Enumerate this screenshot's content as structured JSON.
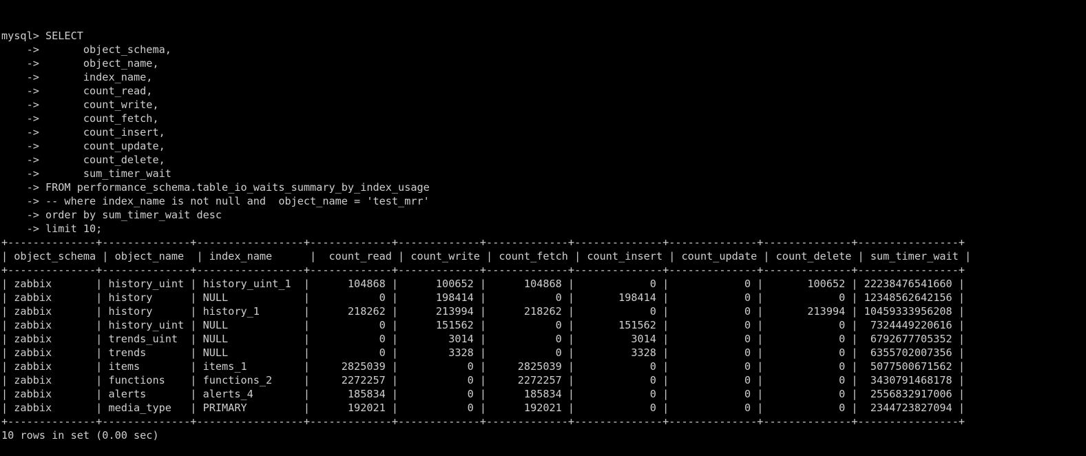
{
  "terminal": {
    "colors": {
      "background": "#000000",
      "foreground": "#cfcfcf"
    },
    "prompt": "mysql> ",
    "continuation": "    -> ",
    "command_first_line": "SELECT",
    "query_lines": [
      "      object_schema,",
      "      object_name,",
      "      index_name,",
      "      count_read,",
      "      count_write,",
      "      count_fetch,",
      "      count_insert,",
      "      count_update,",
      "      count_delete,",
      "      sum_timer_wait",
      "FROM performance_schema.table_io_waits_summary_by_index_usage",
      "-- where index_name is not null and  object_name = 'test_mrr'",
      "order by sum_timer_wait desc",
      "limit 10;"
    ],
    "status_line": "10 rows in set (0.00 sec)"
  },
  "result_table": {
    "columns": [
      {
        "name": "object_schema",
        "width": 13,
        "align": "left"
      },
      {
        "name": "object_name",
        "width": 13,
        "align": "left"
      },
      {
        "name": "index_name",
        "width": 16,
        "align": "left"
      },
      {
        "name": "count_read",
        "width": 12,
        "align": "right"
      },
      {
        "name": "count_write",
        "width": 12,
        "align": "right"
      },
      {
        "name": "count_fetch",
        "width": 12,
        "align": "right"
      },
      {
        "name": "count_insert",
        "width": 13,
        "align": "right"
      },
      {
        "name": "count_update",
        "width": 13,
        "align": "right"
      },
      {
        "name": "count_delete",
        "width": 13,
        "align": "right"
      },
      {
        "name": "sum_timer_wait",
        "width": 15,
        "align": "right"
      }
    ],
    "rows": [
      [
        "zabbix",
        "history_uint",
        "history_uint_1",
        "104868",
        "100652",
        "104868",
        "0",
        "0",
        "100652",
        "22238476541660"
      ],
      [
        "zabbix",
        "history",
        "NULL",
        "0",
        "198414",
        "0",
        "198414",
        "0",
        "0",
        "12348562642156"
      ],
      [
        "zabbix",
        "history",
        "history_1",
        "218262",
        "213994",
        "218262",
        "0",
        "0",
        "213994",
        "10459333956208"
      ],
      [
        "zabbix",
        "history_uint",
        "NULL",
        "0",
        "151562",
        "0",
        "151562",
        "0",
        "0",
        "7324449220616"
      ],
      [
        "zabbix",
        "trends_uint",
        "NULL",
        "0",
        "3014",
        "0",
        "3014",
        "0",
        "0",
        "6792677705352"
      ],
      [
        "zabbix",
        "trends",
        "NULL",
        "0",
        "3328",
        "0",
        "3328",
        "0",
        "0",
        "6355702007356"
      ],
      [
        "zabbix",
        "items",
        "items_1",
        "2825039",
        "0",
        "2825039",
        "0",
        "0",
        "0",
        "5077500671562"
      ],
      [
        "zabbix",
        "functions",
        "functions_2",
        "2272257",
        "0",
        "2272257",
        "0",
        "0",
        "0",
        "3430791468178"
      ],
      [
        "zabbix",
        "alerts",
        "alerts_4",
        "185834",
        "0",
        "185834",
        "0",
        "0",
        "0",
        "2556832917006"
      ],
      [
        "zabbix",
        "media_type",
        "PRIMARY",
        "192021",
        "0",
        "192021",
        "0",
        "0",
        "0",
        "2344723827094"
      ]
    ],
    "row_count": 10
  }
}
